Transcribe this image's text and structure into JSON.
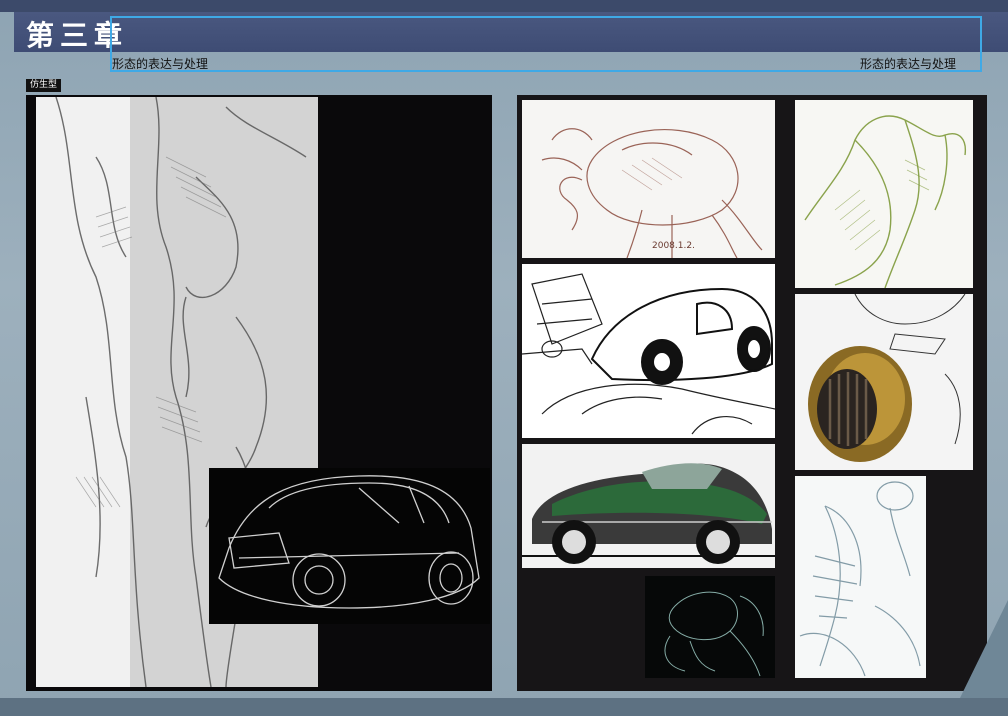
{
  "header": {
    "chapter_title": "第三章",
    "subtitle_left": "形态的表达与处理",
    "subtitle_right": "形态的表达与处理"
  },
  "section": {
    "tag": "仿生型"
  },
  "images": {
    "female_figure_sketch": "female-figure-sketch",
    "car_wireframe_sketch": "car-wireframe-sketch",
    "crab_sketch": "crab-sketch",
    "torso_sketch": "green-torso-sketch",
    "car_interior_sketch": "car-interior-sketch",
    "helmet_render": "helmet-render",
    "green_car_render": "green-car-render",
    "shell_sketch": "seashell-turtle-sketch",
    "dark_crab_sketch": "dark-crab-sketch"
  },
  "colors": {
    "title_bar": "#3e4c74",
    "accent_line": "#3fa9e6",
    "background": "#8ea4b3",
    "panel": "#0a090b"
  }
}
